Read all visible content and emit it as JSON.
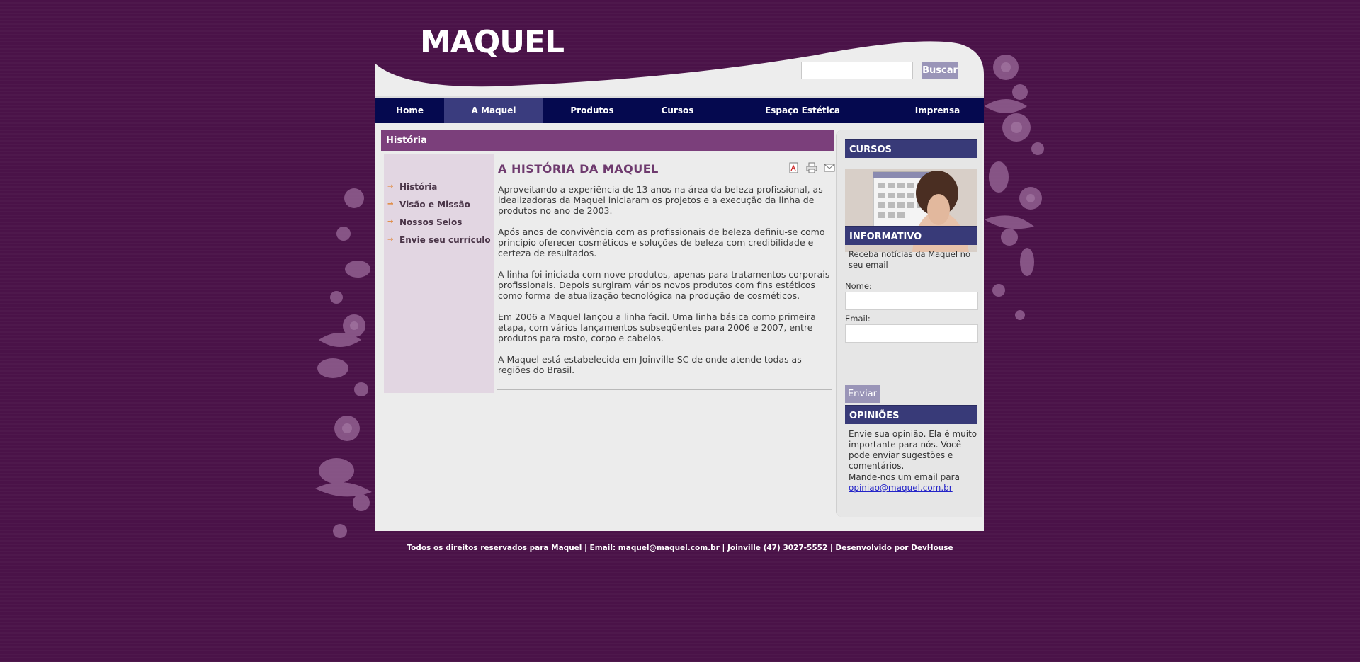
{
  "brand": {
    "logo": "MAQUEL"
  },
  "search": {
    "placeholder": "",
    "value": "",
    "button": "Buscar"
  },
  "nav": {
    "items": [
      {
        "label": "Home"
      },
      {
        "label": "A Maquel"
      },
      {
        "label": "Produtos"
      },
      {
        "label": "Cursos"
      },
      {
        "label": "Espaço Estética"
      },
      {
        "label": "Imprensa"
      }
    ],
    "active": "A Maquel"
  },
  "section": {
    "title": "História"
  },
  "submenu": {
    "items": [
      {
        "label": "História"
      },
      {
        "label": "Visão e Missão"
      },
      {
        "label": "Nossos Selos"
      },
      {
        "label": "Envie seu currículo"
      }
    ]
  },
  "article": {
    "title": "A HISTÓRIA DA MAQUEL",
    "paragraphs": [
      "Aproveitando a experiência de 13 anos na área da beleza profissional, as idealizadoras da Maquel iniciaram os projetos e a execução da linha de produtos no ano de 2003.",
      "Após anos de convivência com as profissionais de beleza definiu-se como princípio oferecer cosméticos e soluções de beleza com credibilidade e certeza de resultados.",
      "A linha foi iniciada com nove produtos, apenas para tratamentos corporais profissionais. Depois surgiram vários novos produtos com fins estéticos como forma de atualização tecnológica na produção de cosméticos.",
      "Em 2006 a Maquel lançou a linha facil. Uma linha básica como primeira etapa, com vários lançamentos subseqüentes para 2006 e 2007, entre produtos para rosto, corpo e cabelos.",
      "A Maquel está estabelecida em Joinville-SC de onde atende todas as regiões do Brasil."
    ],
    "tools": [
      "pdf-icon",
      "print-icon",
      "email-icon"
    ]
  },
  "sidebar": {
    "cursos": {
      "title": "CURSOS"
    },
    "informativo": {
      "title": "INFORMATIVO",
      "text": "Receba notícias da Maquel no seu email",
      "name_label": "Nome:",
      "email_label": "Email:",
      "button": "Enviar"
    },
    "opinioes": {
      "title": "OPINIÕES",
      "text1": "Envie sua opinião. Ela é muito importante para nós. Você pode enviar sugestões e comentários.",
      "text2": "Mande-nos um email para",
      "email": "opiniao@maquel.com.br"
    }
  },
  "footer": {
    "text": "Todos os direitos reservados para Maquel | Email: maquel@maquel.com.br | Joinville (47) 3027-5552 | Desenvolvido por DevHouse"
  },
  "colors": {
    "background": "#4a1248",
    "nav": "#05094f",
    "nav_active": "#3a3c7e",
    "section_bar": "#7b3f7b",
    "side_header": "#383a78",
    "button": "#9a95b8",
    "bullet": "#e07a1f"
  }
}
